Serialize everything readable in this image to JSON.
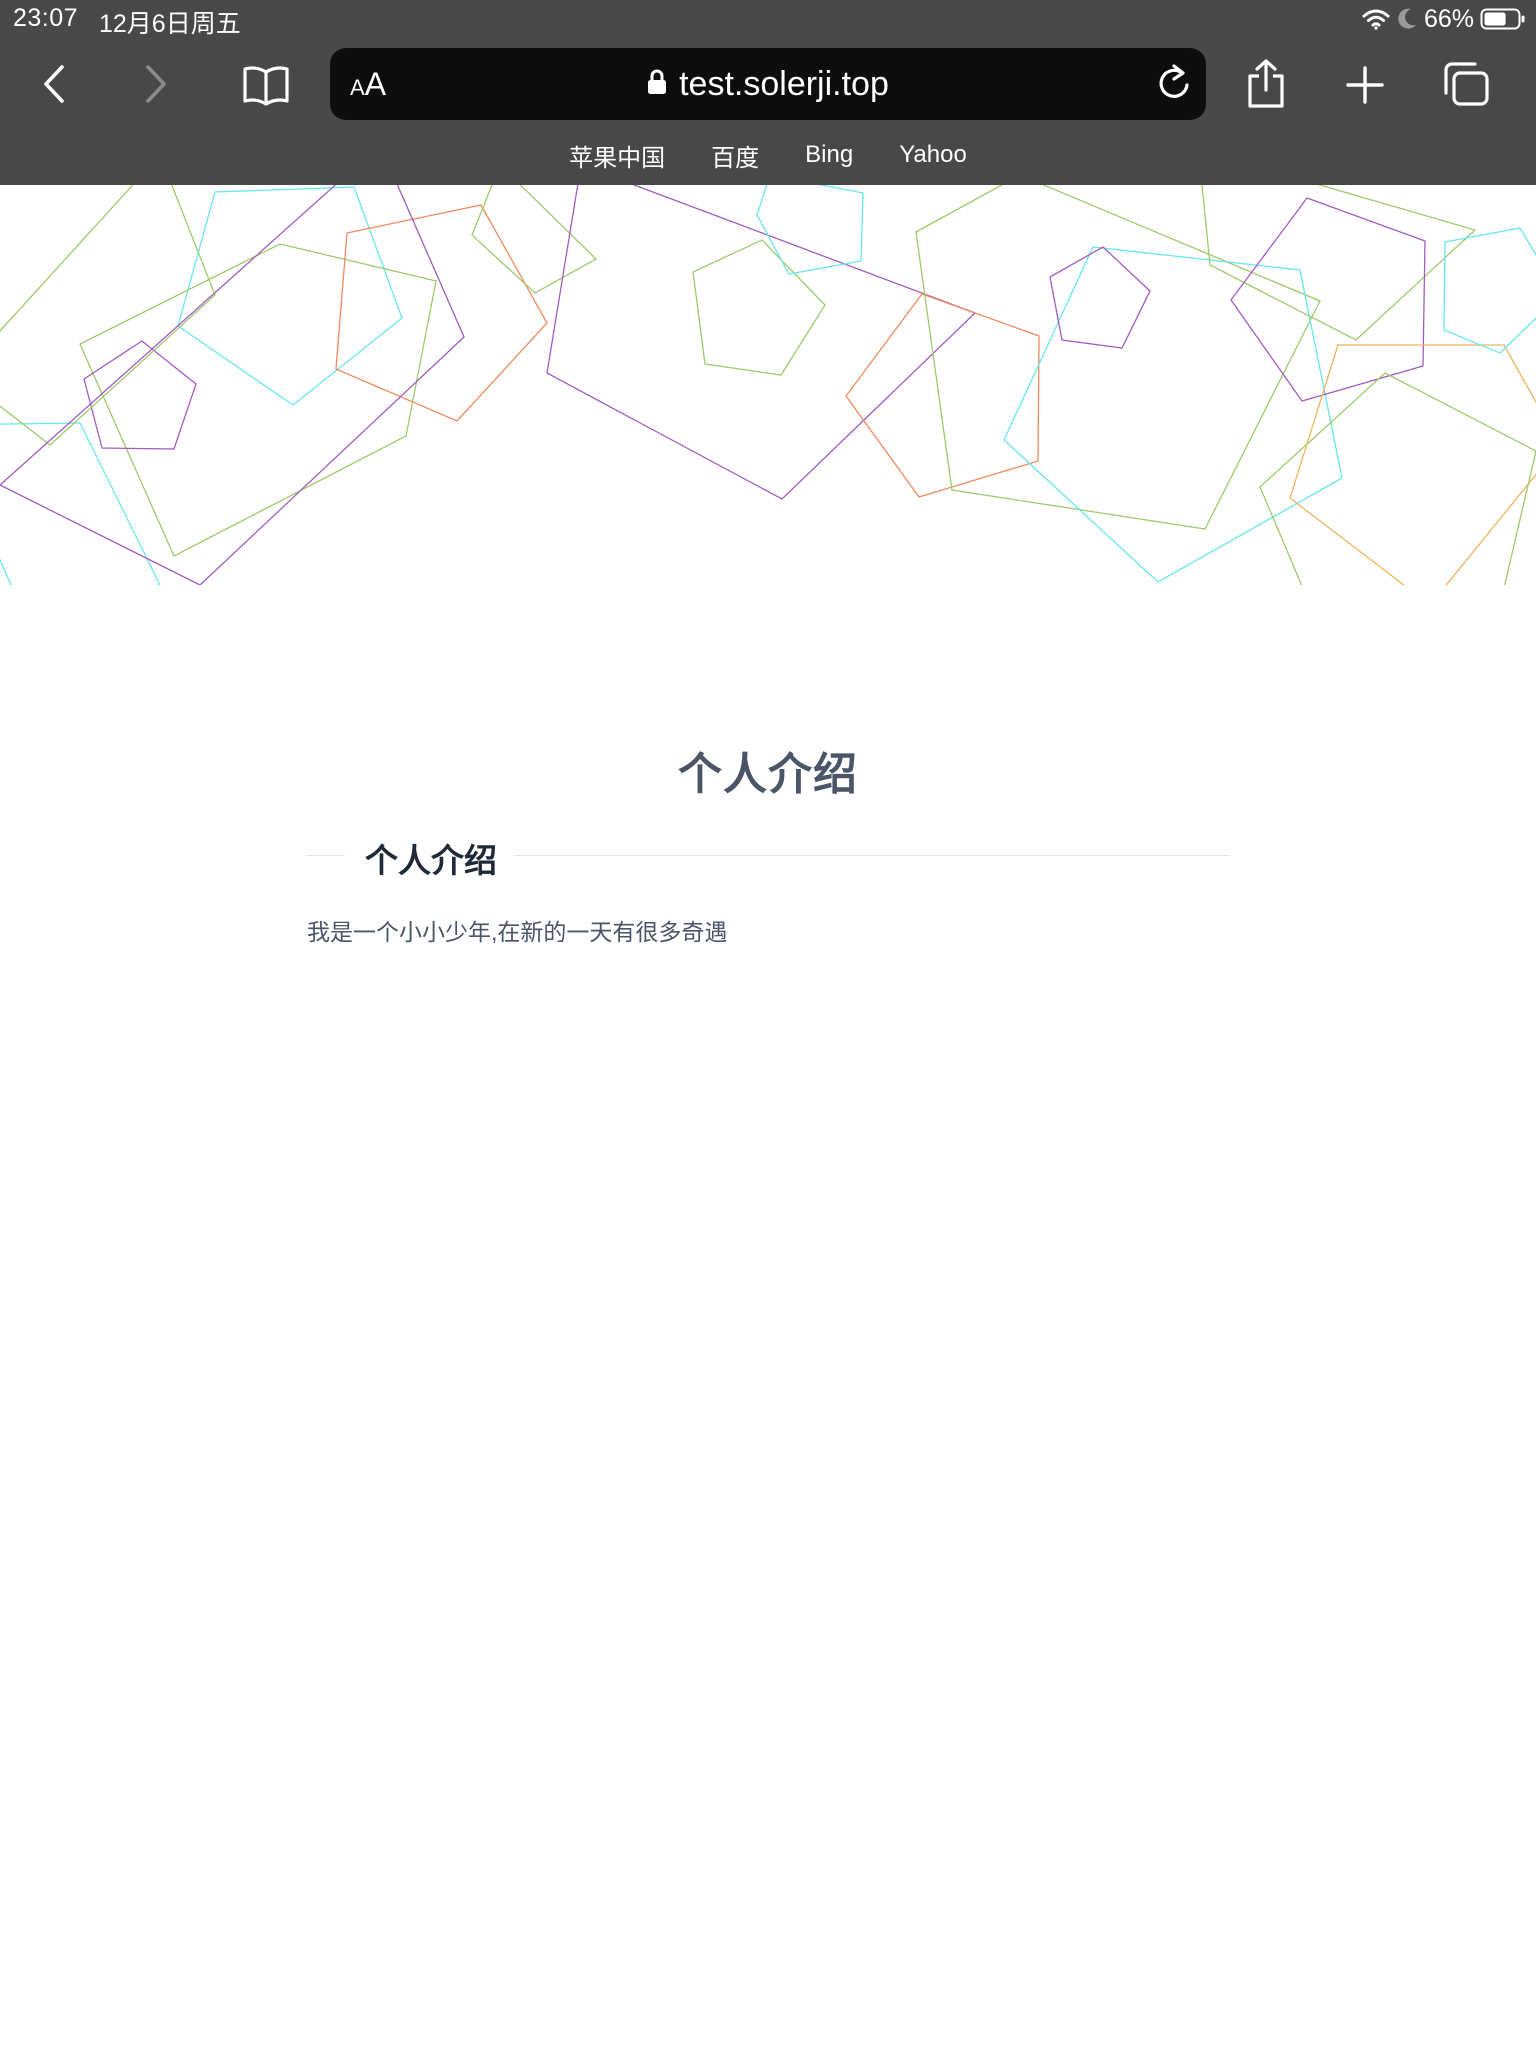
{
  "status_bar": {
    "time": "23:07",
    "date": "12月6日周五",
    "battery_percent": "66%",
    "battery_level": 0.66,
    "icons": [
      "wifi-icon",
      "moon-icon",
      "battery-icon"
    ]
  },
  "toolbar": {
    "icons": [
      "back-icon",
      "forward-icon",
      "bookmarks-icon",
      "reload-icon",
      "share-icon",
      "new-tab-icon",
      "tabs-icon"
    ],
    "reader_small": "A",
    "reader_large": "A",
    "url": "test.solerji.top"
  },
  "favorites": [
    "苹果中国",
    "百度",
    "Bing",
    "Yahoo"
  ],
  "page": {
    "title": "个人介绍",
    "section_title": "个人介绍",
    "intro": "我是一个小小少年,在新的一天有很多奇遇"
  },
  "colors": {
    "chrome_bg": "#484848",
    "address_bg": "#0d0d0d",
    "shape_green": "#9ecb6a",
    "shape_cyan": "#66e7f0",
    "shape_purple": "#a35bc3",
    "shape_orange": "#f08a5d"
  }
}
